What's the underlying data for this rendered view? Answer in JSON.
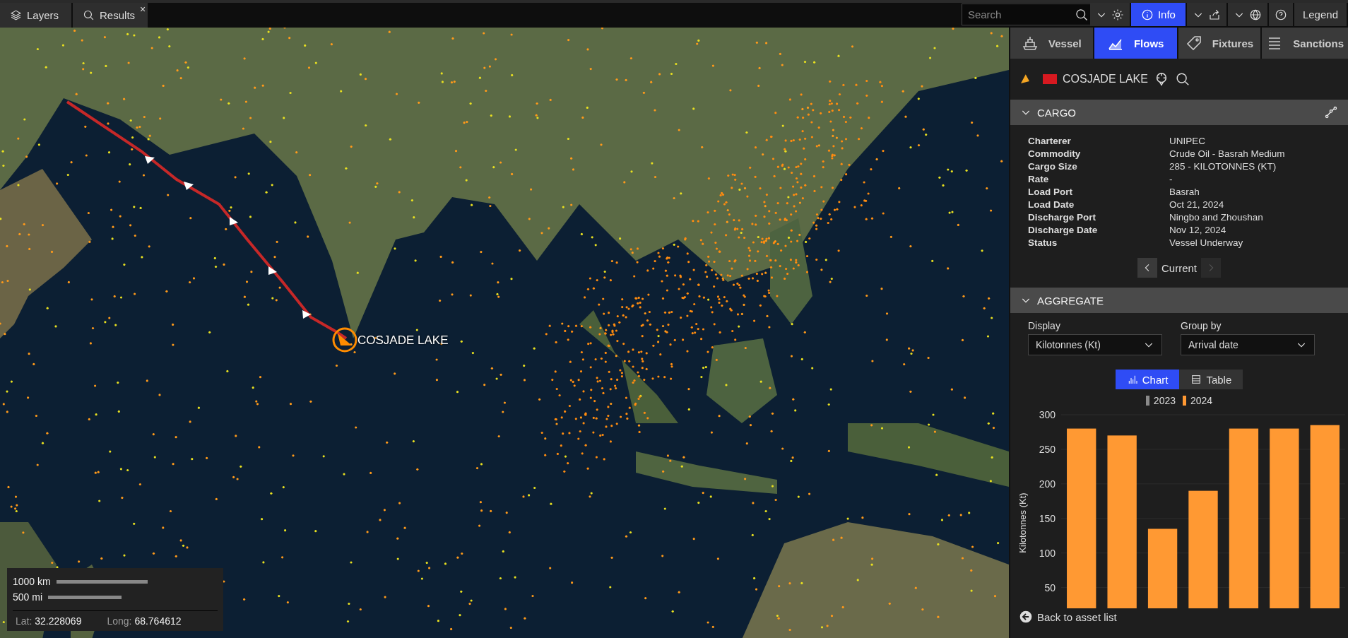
{
  "top_bar": {
    "tabs": [
      {
        "label": "Layers",
        "kind": "layers"
      },
      {
        "label": "Results",
        "kind": "search",
        "close": "×"
      }
    ],
    "search": {
      "placeholder": "Search"
    },
    "info_button": {
      "label": "Info",
      "selected": true
    },
    "legend_button": {
      "label": "Legend"
    }
  },
  "map": {
    "vessel_label": "COSJADE LAKE"
  },
  "scale": {
    "km": "1000 km",
    "mi": "500 mi",
    "lat_label": "Lat:",
    "lat": "32.228069",
    "long_label": "Long:",
    "long": "68.764612"
  },
  "panel": {
    "tabs": [
      {
        "label": "Vessel",
        "kind": "ship",
        "selected": false
      },
      {
        "label": "Flows",
        "kind": "chart",
        "selected": true
      },
      {
        "label": "Fixtures",
        "kind": "tag",
        "selected": false
      },
      {
        "label": "Sanctions",
        "kind": "list",
        "selected": false
      }
    ],
    "vessel": {
      "name": "COSJADE LAKE"
    },
    "cargo": {
      "title": "CARGO",
      "expanded": true,
      "fields": [
        {
          "label": "Charterer",
          "value": "UNIPEC"
        },
        {
          "label": "Commodity",
          "value": "Crude Oil - Basrah Medium"
        },
        {
          "label": "Cargo Size",
          "value": "285 - KILOTONNES (KT)"
        },
        {
          "label": "Rate",
          "value": "-"
        },
        {
          "label": "Load Port",
          "value": "Basrah"
        },
        {
          "label": "Load Date",
          "value": "Oct 21, 2024"
        },
        {
          "label": "Discharge Port",
          "value": "Ningbo and Zhoushan"
        },
        {
          "label": "Discharge Date",
          "value": "Nov 12, 2024"
        },
        {
          "label": "Status",
          "value": "Vessel Underway"
        }
      ],
      "navigation": {
        "label": "Current",
        "next_disabled": true
      }
    },
    "aggregate": {
      "title": "AGGREGATE",
      "expanded": true,
      "display": {
        "label": "Display",
        "value": "Kilotonnes (Kt)"
      },
      "group_by": {
        "label": "Group by",
        "value": "Arrival date"
      },
      "view_toggle": [
        {
          "label": "Chart",
          "kind": "bars",
          "selected": true
        },
        {
          "label": "Table",
          "kind": "table",
          "selected": false
        }
      ],
      "chart_data": {
        "type": "bar",
        "ylabel": "Kilotonnes (Kt)",
        "ylim": [
          20,
          300
        ],
        "yticks": [
          50,
          100,
          150,
          200,
          250,
          300
        ],
        "grid": true,
        "series": [
          {
            "name": "2023",
            "color": "#8a8a8a",
            "values": [
              null,
              null,
              null,
              null,
              null,
              null,
              null
            ]
          },
          {
            "name": "2024",
            "color": "#ff9933",
            "values": [
              280,
              270,
              135,
              190,
              280,
              280,
              285
            ]
          }
        ]
      }
    },
    "back_link": "Back to asset list"
  }
}
